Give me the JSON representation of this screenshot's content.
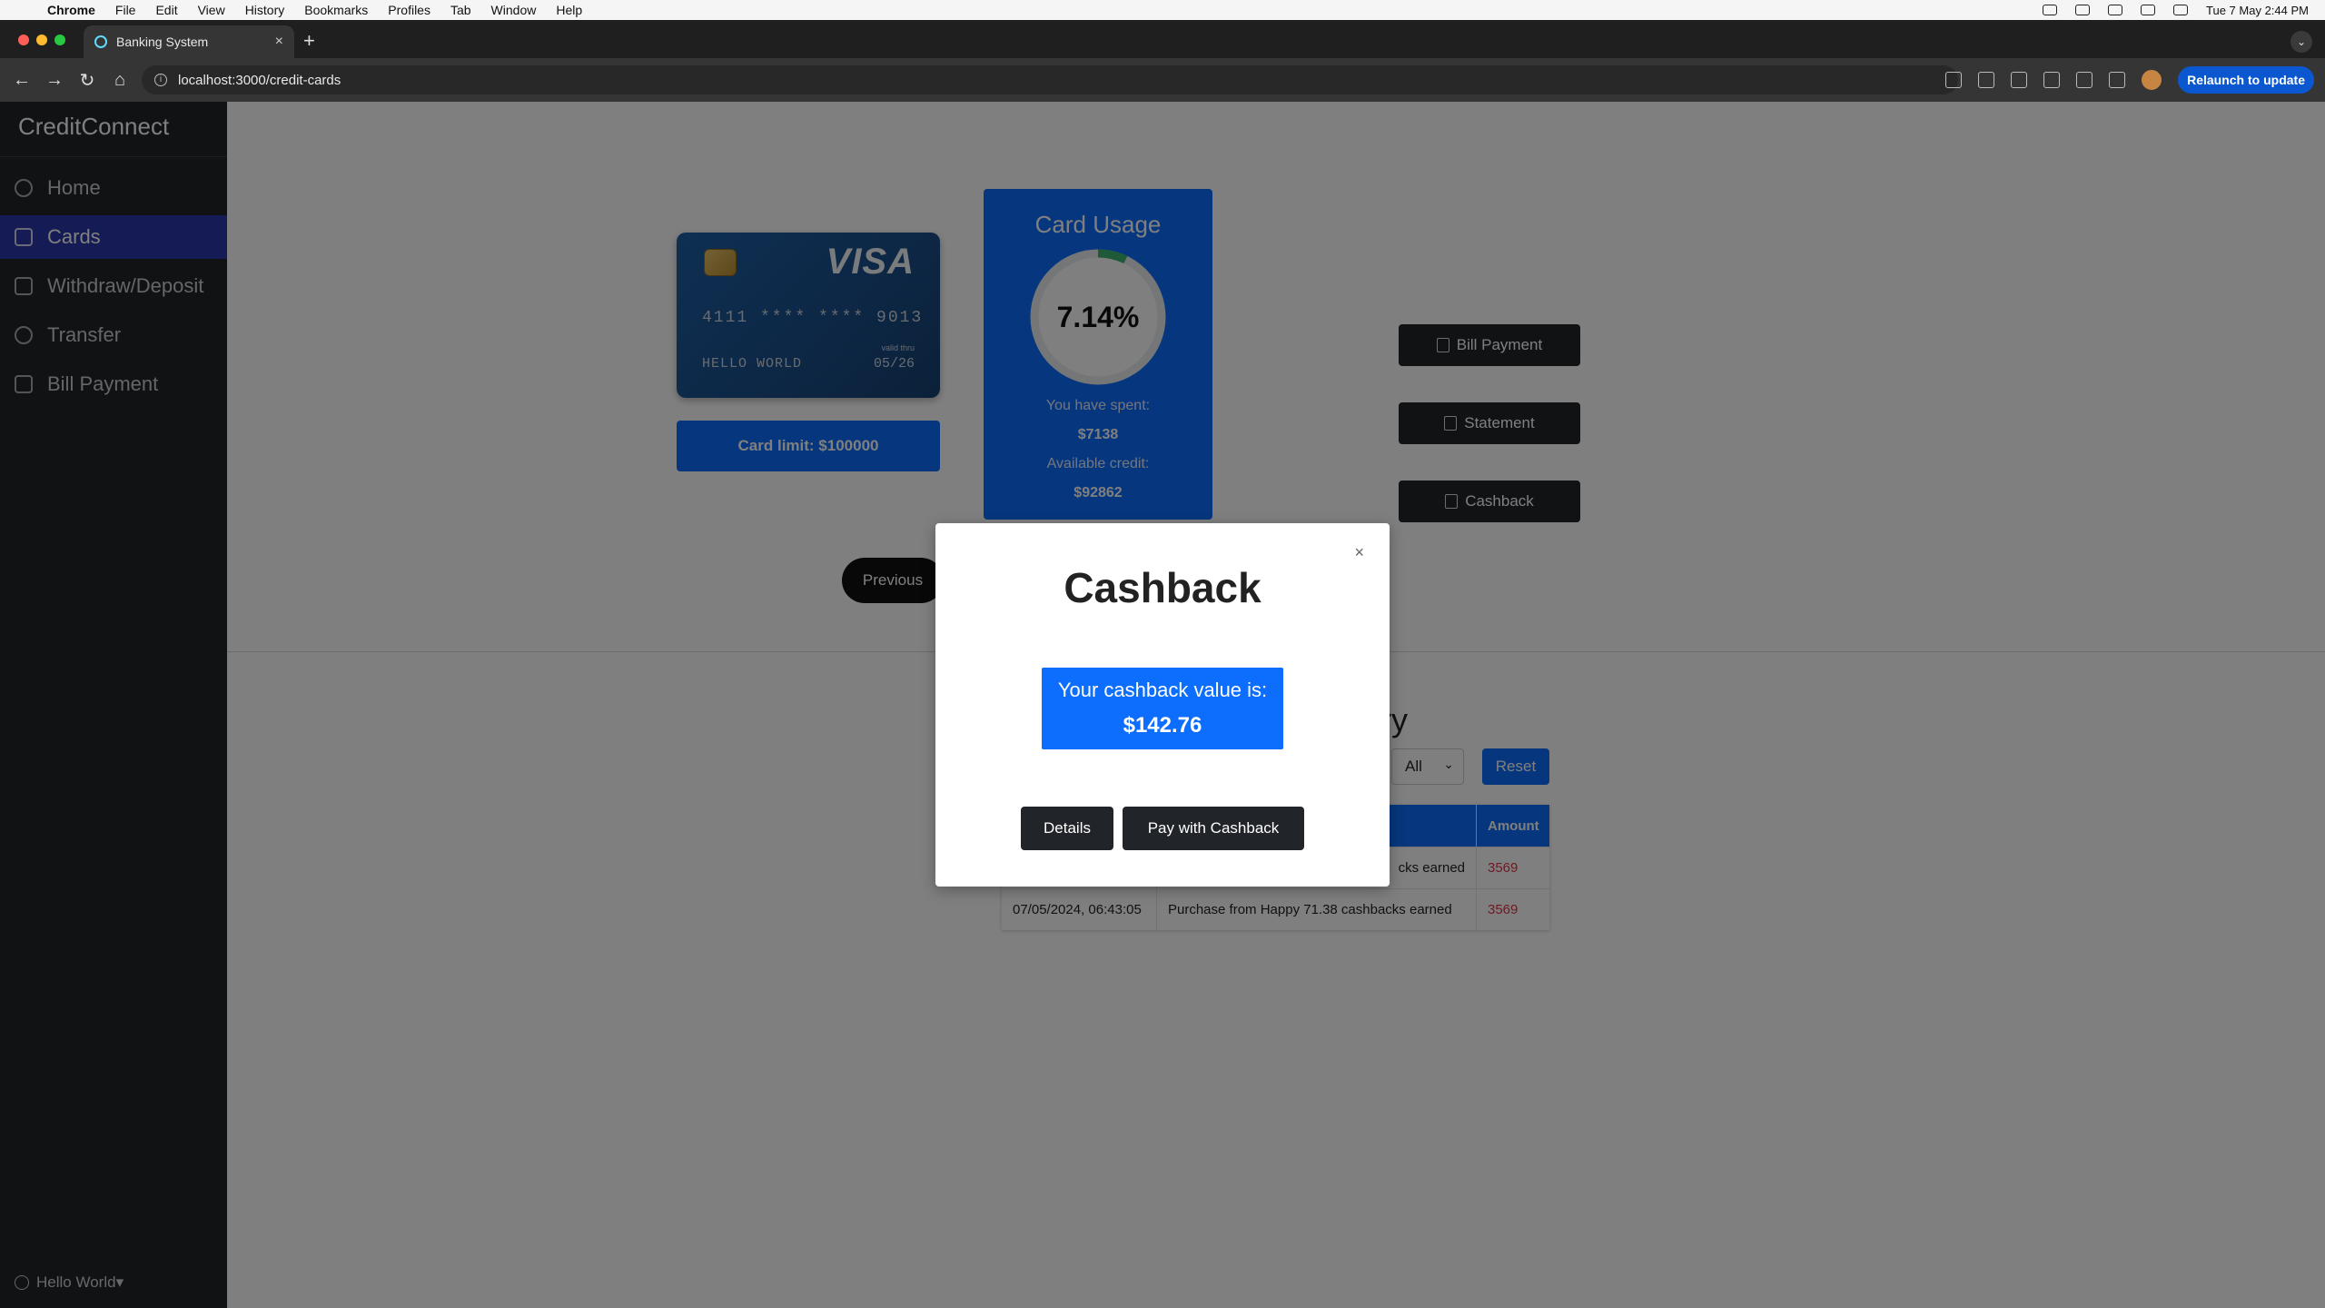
{
  "menubar": {
    "app": "Chrome",
    "items": [
      "File",
      "Edit",
      "View",
      "History",
      "Bookmarks",
      "Profiles",
      "Tab",
      "Window",
      "Help"
    ],
    "clock": "Tue 7 May  2:44 PM"
  },
  "browser": {
    "tab_title": "Banking System",
    "url": "localhost:3000/credit-cards",
    "relaunch_label": "Relaunch to update"
  },
  "sidebar": {
    "brand": "CreditConnect",
    "items": [
      {
        "label": "Home",
        "icon": "gauge-icon"
      },
      {
        "label": "Cards",
        "icon": "credit-card-icon",
        "active": true
      },
      {
        "label": "Withdraw/Deposit",
        "icon": "wallet-icon"
      },
      {
        "label": "Transfer",
        "icon": "arrow-circle-icon"
      },
      {
        "label": "Bill Payment",
        "icon": "receipt-icon"
      }
    ],
    "user": "Hello World"
  },
  "card": {
    "brand": "VISA",
    "number": "4111 **** **** 9013",
    "holder": "HELLO WORLD",
    "valid_label": "valid thru",
    "expiry": "05/26",
    "limit_label": "Card limit: $100000"
  },
  "usage": {
    "title": "Card Usage",
    "percent_text": "7.14%",
    "percent_value": 7.14,
    "spent_label": "You have spent:",
    "spent_value": "$7138",
    "available_label": "Available credit:",
    "available_value": "$92862"
  },
  "actions": {
    "bill_payment": "Bill Payment",
    "statement": "Statement",
    "cashback": "Cashback"
  },
  "pager": {
    "previous": "Previous"
  },
  "history": {
    "title_visible": "ry",
    "filter_value": "All",
    "reset_label": "Reset",
    "columns": [
      "",
      "",
      "Amount"
    ],
    "rows": [
      {
        "date": "",
        "description": "cks earned",
        "amount": "3569"
      },
      {
        "date": "07/05/2024, 06:43:05",
        "description": "Purchase from Happy 71.38 cashbacks earned",
        "amount": "3569"
      }
    ]
  },
  "modal": {
    "title": "Cashback",
    "close": "×",
    "value_label": "Your cashback value is:",
    "value": "$142.76",
    "details_label": "Details",
    "pay_label": "Pay with Cashback"
  },
  "colors": {
    "primary": "#0d6efd",
    "sidebar_bg": "#212529",
    "sidebar_active": "#2b36a9",
    "amount_red": "#dc3545",
    "gauge_fill": "#3cb371"
  }
}
